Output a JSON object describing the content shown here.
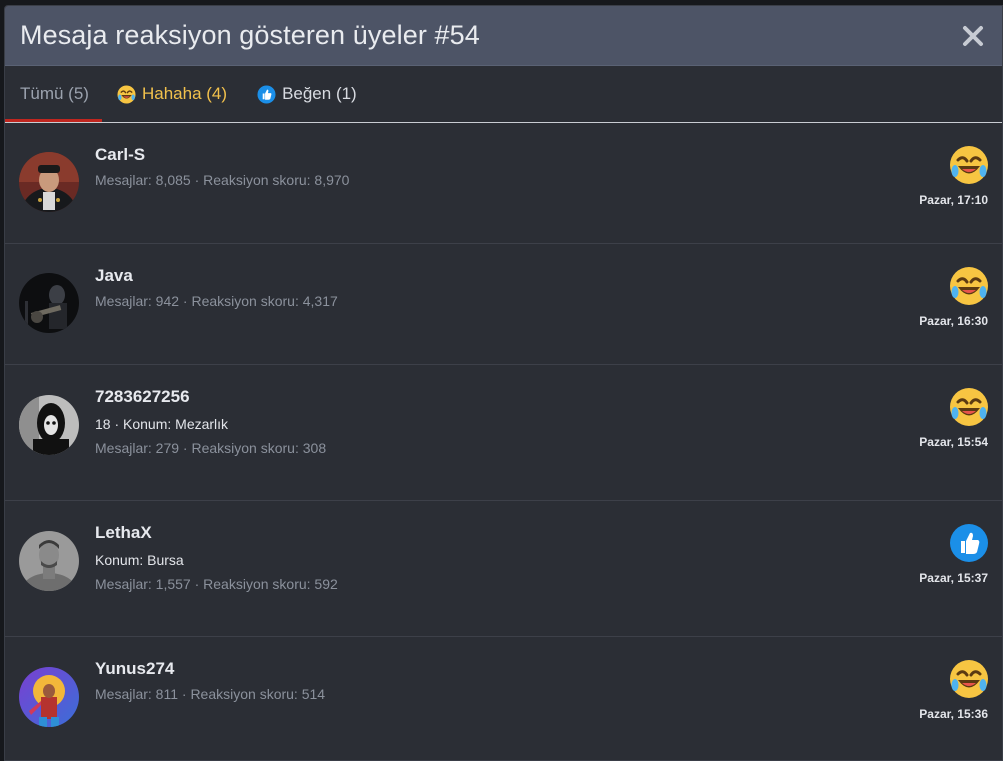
{
  "modal": {
    "title": "Mesaja reaksiyon gösteren üyeler #54"
  },
  "tabs": [
    {
      "label": "Tümü (5)"
    },
    {
      "label": "Hahaha (4)",
      "icon": "laughing-emoji-icon"
    },
    {
      "label": "Beğen (1)",
      "icon": "thumbs-up-icon"
    }
  ],
  "colors": {
    "header_bg": "#4d5466",
    "modal_bg": "#2b2e35",
    "active_tab_underline": "#c0261f",
    "haha_tab": "#f2c14c",
    "like_blue": "#1b8fe8"
  },
  "members": [
    {
      "username": "Carl-S",
      "extra": "",
      "stats": "Mesajlar: 8,085 · Reaksiyon skoru: 8,970",
      "reaction": "haha",
      "time": "Pazar, 17:10"
    },
    {
      "username": "Java",
      "extra": "",
      "stats": "Mesajlar: 942 · Reaksiyon skoru: 4,317",
      "reaction": "haha",
      "time": "Pazar, 16:30"
    },
    {
      "username": "7283627256",
      "extra": "18 · Konum: Mezarlık",
      "stats": "Mesajlar: 279 · Reaksiyon skoru: 308",
      "reaction": "haha",
      "time": "Pazar, 15:54"
    },
    {
      "username": "LethaX",
      "extra": "Konum: Bursa",
      "stats": "Mesajlar: 1,557 · Reaksiyon skoru: 592",
      "reaction": "like",
      "time": "Pazar, 15:37"
    },
    {
      "username": "Yunus274",
      "extra": "",
      "stats": "Mesajlar: 811 · Reaksiyon skoru: 514",
      "reaction": "haha",
      "time": "Pazar, 15:36"
    }
  ]
}
